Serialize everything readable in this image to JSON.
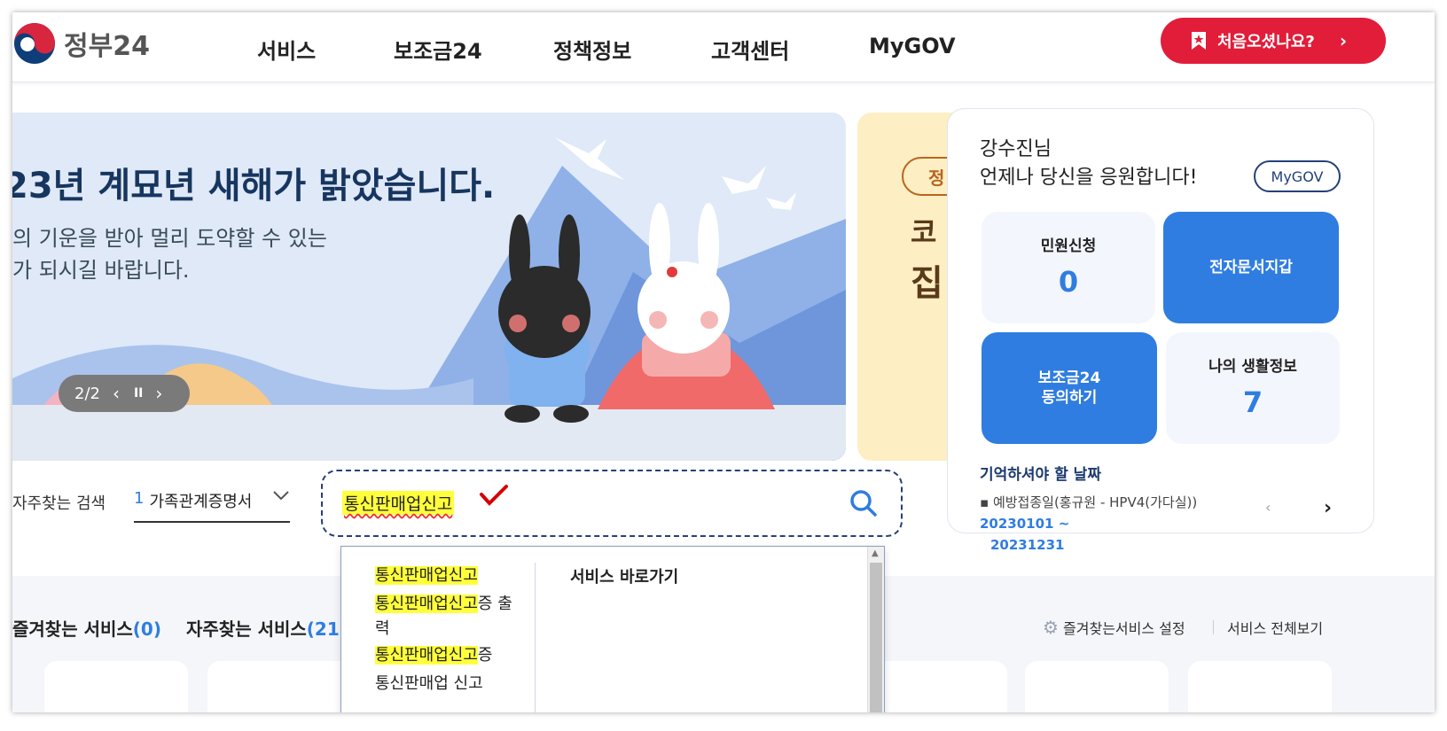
{
  "header": {
    "logo_text": "정부24",
    "nav": [
      "서비스",
      "보조금24",
      "정책정보",
      "고객센터",
      "MyGOV"
    ],
    "first_visit_button": "처음오셨나요?"
  },
  "banner": {
    "title": "23년 계묘년 새해가 밝았습니다.",
    "subtitle_line1": "의 기운을 받아 멀리 도약할 수 있는",
    "subtitle_line2": "가 되시길 바랍니다.",
    "slide_indicator": "2/2",
    "next_banner_pill": "정",
    "next_banner_line1": "코",
    "next_banner_line2": "집"
  },
  "user_card": {
    "name": "강수진님",
    "message": "언제나 당신을 응원합니다!",
    "mygov_button": "MyGOV",
    "tiles": [
      {
        "label": "민원신청",
        "value": "0"
      },
      {
        "label": "전자문서지갑"
      },
      {
        "label_line1": "보조금24",
        "label_line2": "동의하기"
      },
      {
        "label": "나의 생활정보",
        "value": "7"
      }
    ],
    "remember_title": "기억하셔야 할 날짜",
    "remember_item_text": "예방접종일(홍규원 - HPV4(가다실))",
    "remember_item_date_start": "20230101 ~",
    "remember_item_date_end": "20231231"
  },
  "search": {
    "frequent_label": "자주찾는 검색",
    "frequent_rank": "1",
    "frequent_value": "가족관계증명서",
    "input_value": "통신판매업신고"
  },
  "autocomplete": {
    "items": [
      {
        "hl": "통신판매업신고",
        "rest": ""
      },
      {
        "hl": "통신판매업신고",
        "rest": "증 출"
      },
      {
        "hl": "",
        "rest": "력"
      },
      {
        "hl": "통신판매업신고",
        "rest": "증"
      },
      {
        "hl": "",
        "rest": "통신판매업 신고"
      }
    ],
    "shortcut_label": "서비스 바로가기"
  },
  "services": {
    "favorites_label": "즐겨찾는 서비스",
    "favorites_count": "(0)",
    "frequent_label": "자주찾는 서비스",
    "frequent_count": "(21)",
    "settings_link": "즐겨찾는서비스 설정",
    "view_all_link": "서비스 전체보기"
  },
  "colors": {
    "primary_blue": "#2f7de1",
    "brand_red": "#e11d3a",
    "navy": "#25407a",
    "highlight_yellow": "#ffff3c"
  }
}
